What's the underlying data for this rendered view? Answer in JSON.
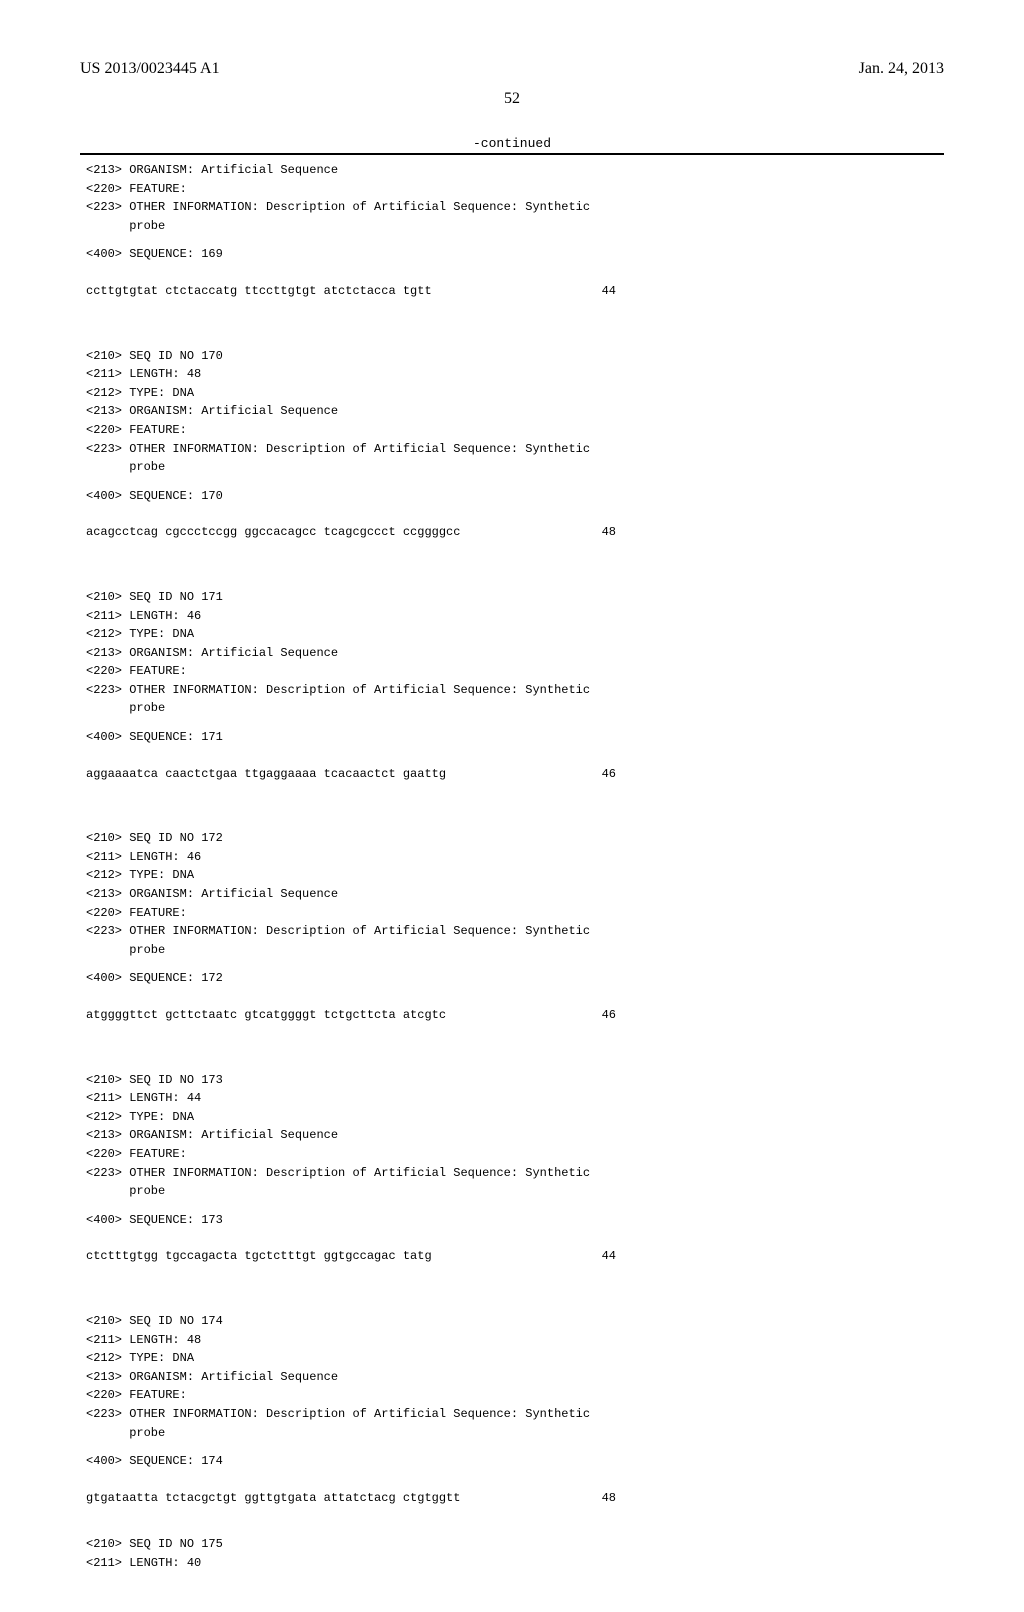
{
  "header": {
    "doc_id": "US 2013/0023445 A1",
    "date": "Jan. 24, 2013"
  },
  "page_number": "52",
  "continued_label": "-continued",
  "entries": [
    {
      "prefix_lines": [
        "<213> ORGANISM: Artificial Sequence",
        "<220> FEATURE:",
        "<223> OTHER INFORMATION: Description of Artificial Sequence: Synthetic",
        "      probe"
      ],
      "seq_label": "<400> SEQUENCE: 169",
      "sequence": "ccttgtgtat ctctaccatg ttccttgtgt atctctacca tgtt",
      "length_num": "44"
    },
    {
      "prefix_lines": [
        "<210> SEQ ID NO 170",
        "<211> LENGTH: 48",
        "<212> TYPE: DNA",
        "<213> ORGANISM: Artificial Sequence",
        "<220> FEATURE:",
        "<223> OTHER INFORMATION: Description of Artificial Sequence: Synthetic",
        "      probe"
      ],
      "seq_label": "<400> SEQUENCE: 170",
      "sequence": "acagcctcag cgccctccgg ggccacagcc tcagcgccct ccggggcc",
      "length_num": "48"
    },
    {
      "prefix_lines": [
        "<210> SEQ ID NO 171",
        "<211> LENGTH: 46",
        "<212> TYPE: DNA",
        "<213> ORGANISM: Artificial Sequence",
        "<220> FEATURE:",
        "<223> OTHER INFORMATION: Description of Artificial Sequence: Synthetic",
        "      probe"
      ],
      "seq_label": "<400> SEQUENCE: 171",
      "sequence": "aggaaaatca caactctgaa ttgaggaaaa tcacaactct gaattg",
      "length_num": "46"
    },
    {
      "prefix_lines": [
        "<210> SEQ ID NO 172",
        "<211> LENGTH: 46",
        "<212> TYPE: DNA",
        "<213> ORGANISM: Artificial Sequence",
        "<220> FEATURE:",
        "<223> OTHER INFORMATION: Description of Artificial Sequence: Synthetic",
        "      probe"
      ],
      "seq_label": "<400> SEQUENCE: 172",
      "sequence": "atggggttct gcttctaatc gtcatggggt tctgcttcta atcgtc",
      "length_num": "46"
    },
    {
      "prefix_lines": [
        "<210> SEQ ID NO 173",
        "<211> LENGTH: 44",
        "<212> TYPE: DNA",
        "<213> ORGANISM: Artificial Sequence",
        "<220> FEATURE:",
        "<223> OTHER INFORMATION: Description of Artificial Sequence: Synthetic",
        "      probe"
      ],
      "seq_label": "<400> SEQUENCE: 173",
      "sequence": "ctctttgtgg tgccagacta tgctctttgt ggtgccagac tatg",
      "length_num": "44"
    },
    {
      "prefix_lines": [
        "<210> SEQ ID NO 174",
        "<211> LENGTH: 48",
        "<212> TYPE: DNA",
        "<213> ORGANISM: Artificial Sequence",
        "<220> FEATURE:",
        "<223> OTHER INFORMATION: Description of Artificial Sequence: Synthetic",
        "      probe"
      ],
      "seq_label": "<400> SEQUENCE: 174",
      "sequence": "gtgataatta tctacgctgt ggttgtgata attatctacg ctgtggtt",
      "length_num": "48"
    }
  ],
  "trailing_lines": [
    "<210> SEQ ID NO 175",
    "<211> LENGTH: 40"
  ]
}
